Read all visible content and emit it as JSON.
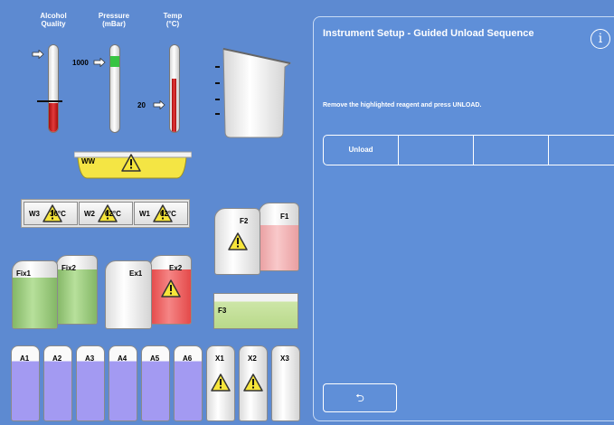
{
  "gauges": {
    "alcohol_quality": {
      "label_line1": "Alcohol",
      "label_line2": "Quality"
    },
    "pressure": {
      "label_line1": "Pressure",
      "label_line2": "(mBar)",
      "value_label": "1000"
    },
    "temp": {
      "label_line1": "Temp",
      "label_line2": "(°C)",
      "value_label": "20"
    }
  },
  "wax_bath": {
    "label": "WW"
  },
  "wax_chambers": [
    {
      "name": "W3",
      "temp": "36°C"
    },
    {
      "name": "W2",
      "temp": "62°C"
    },
    {
      "name": "W1",
      "temp": "62°C"
    }
  ],
  "formalin": [
    {
      "name": "F2"
    },
    {
      "name": "F1"
    }
  ],
  "fixatives": [
    {
      "name": "Fix1"
    },
    {
      "name": "Fix2"
    }
  ],
  "exchange": [
    {
      "name": "Ex1"
    },
    {
      "name": "Ex2"
    }
  ],
  "f3_tray": {
    "name": "F3"
  },
  "alcohol_bottles": [
    {
      "name": "A1"
    },
    {
      "name": "A2"
    },
    {
      "name": "A3"
    },
    {
      "name": "A4"
    },
    {
      "name": "A5"
    },
    {
      "name": "A6"
    }
  ],
  "xylene_bottles": [
    {
      "name": "X1"
    },
    {
      "name": "X2"
    },
    {
      "name": "X3"
    }
  ],
  "panel": {
    "title": "Instrument Setup - Guided Unload Sequence",
    "info_icon": "i",
    "message": "Remove the highlighted reagent and press UNLOAD.",
    "tabs": [
      "Unload",
      "",
      "",
      ""
    ],
    "back_symbol": "⮌"
  },
  "colors": {
    "background": "#5d8ad1",
    "alcohol": "#9e96f4",
    "fixative": "#a5d188",
    "warning_yellow": "#f6e53a",
    "exchange_red": "#ef6363",
    "formalin_pink": "#f4b4b6"
  }
}
